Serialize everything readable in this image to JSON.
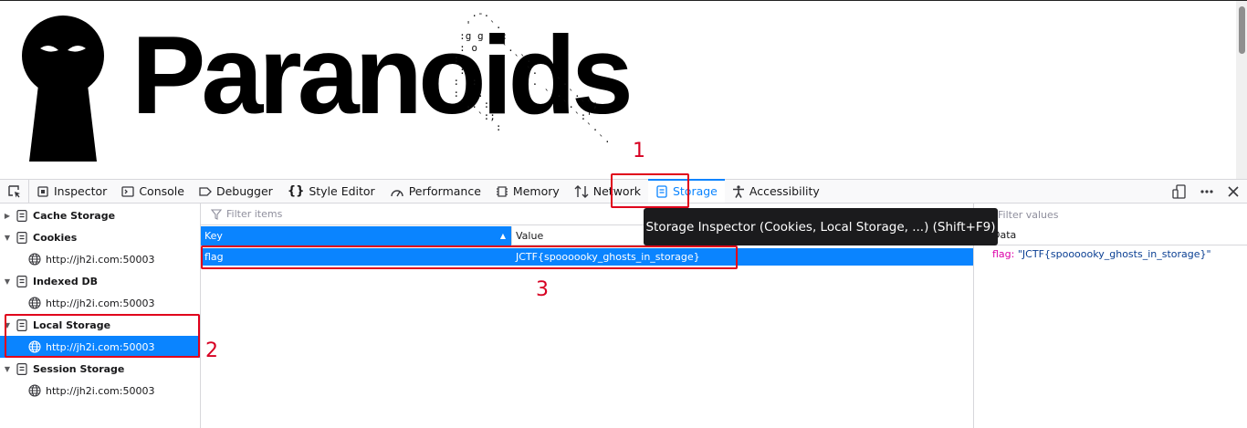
{
  "webpage": {
    "logo_text": "Paranoids",
    "ascii_art": "       .-.\n      '   `.\n     :g g   :\n     : o    `.\n    :         ``.\n     :          `.\n    :  :         .   `.\n    :   :          ` . `.\n     `.. :            `. ``;\n        `:;             `:'\n           :              `.\n                            `."
  },
  "annotations": [
    "1",
    "2",
    "3"
  ],
  "toolbar": {
    "tabs": [
      {
        "label": "Inspector",
        "icon": "inspector-icon"
      },
      {
        "label": "Console",
        "icon": "console-icon"
      },
      {
        "label": "Debugger",
        "icon": "debugger-icon"
      },
      {
        "label": "Style Editor",
        "icon": "style-editor-icon"
      },
      {
        "label": "Performance",
        "icon": "performance-icon"
      },
      {
        "label": "Memory",
        "icon": "memory-icon"
      },
      {
        "label": "Network",
        "icon": "network-icon"
      },
      {
        "label": "Storage",
        "icon": "storage-icon"
      },
      {
        "label": "Accessibility",
        "icon": "accessibility-icon"
      }
    ],
    "selected_tab": "Storage"
  },
  "tree": {
    "cache_storage": "Cache Storage",
    "cookies": "Cookies",
    "cookies_host": "http://jh2i.com:50003",
    "indexed_db": "Indexed DB",
    "indexed_db_host": "http://jh2i.com:50003",
    "local_storage": "Local Storage",
    "local_storage_host": "http://jh2i.com:50003",
    "session_storage": "Session Storage",
    "session_storage_host": "http://jh2i.com:50003"
  },
  "table": {
    "filter_placeholder": "Filter items",
    "columns": [
      "Key",
      "Value"
    ],
    "rows": [
      {
        "key": "flag",
        "value": "JCTF{spoooooky_ghosts_in_storage}"
      }
    ]
  },
  "tooltip": "Storage Inspector (Cookies, Local Storage, ...) (Shift+F9)",
  "sidebar": {
    "filter_placeholder": "Filter values",
    "header": "Data",
    "prop_key": "flag:",
    "prop_value": "\"JCTF{spoooooky_ghosts_in_storage}\""
  },
  "colors": {
    "accent": "#0a84ff",
    "annotation": "#e0001b"
  }
}
